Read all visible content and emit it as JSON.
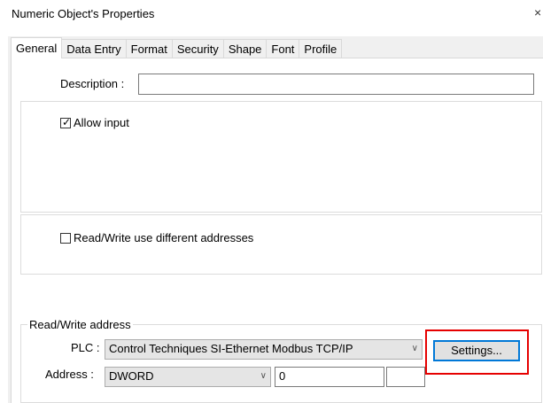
{
  "window": {
    "title": "Numeric Object's Properties",
    "close_glyph": "×"
  },
  "tabs": [
    {
      "label": "General",
      "active": true
    },
    {
      "label": "Data Entry",
      "active": false
    },
    {
      "label": "Format",
      "active": false
    },
    {
      "label": "Security",
      "active": false
    },
    {
      "label": "Shape",
      "active": false
    },
    {
      "label": "Font",
      "active": false
    },
    {
      "label": "Profile",
      "active": false
    }
  ],
  "general": {
    "description_label": "Description :",
    "description_value": "",
    "allow_input_label": "Allow input",
    "allow_input_checked": true,
    "rw_diff_label": "Read/Write use different addresses",
    "rw_diff_checked": false,
    "rw_group_title": "Read/Write address",
    "plc_label": "PLC :",
    "plc_value": "Control Techniques SI-Ethernet Modbus TCP/IP",
    "settings_label": "Settings...",
    "address_label": "Address :",
    "address_type": "DWORD",
    "address_value": "0"
  },
  "colors": {
    "highlight": "#e60000",
    "focus": "#0078d7"
  }
}
